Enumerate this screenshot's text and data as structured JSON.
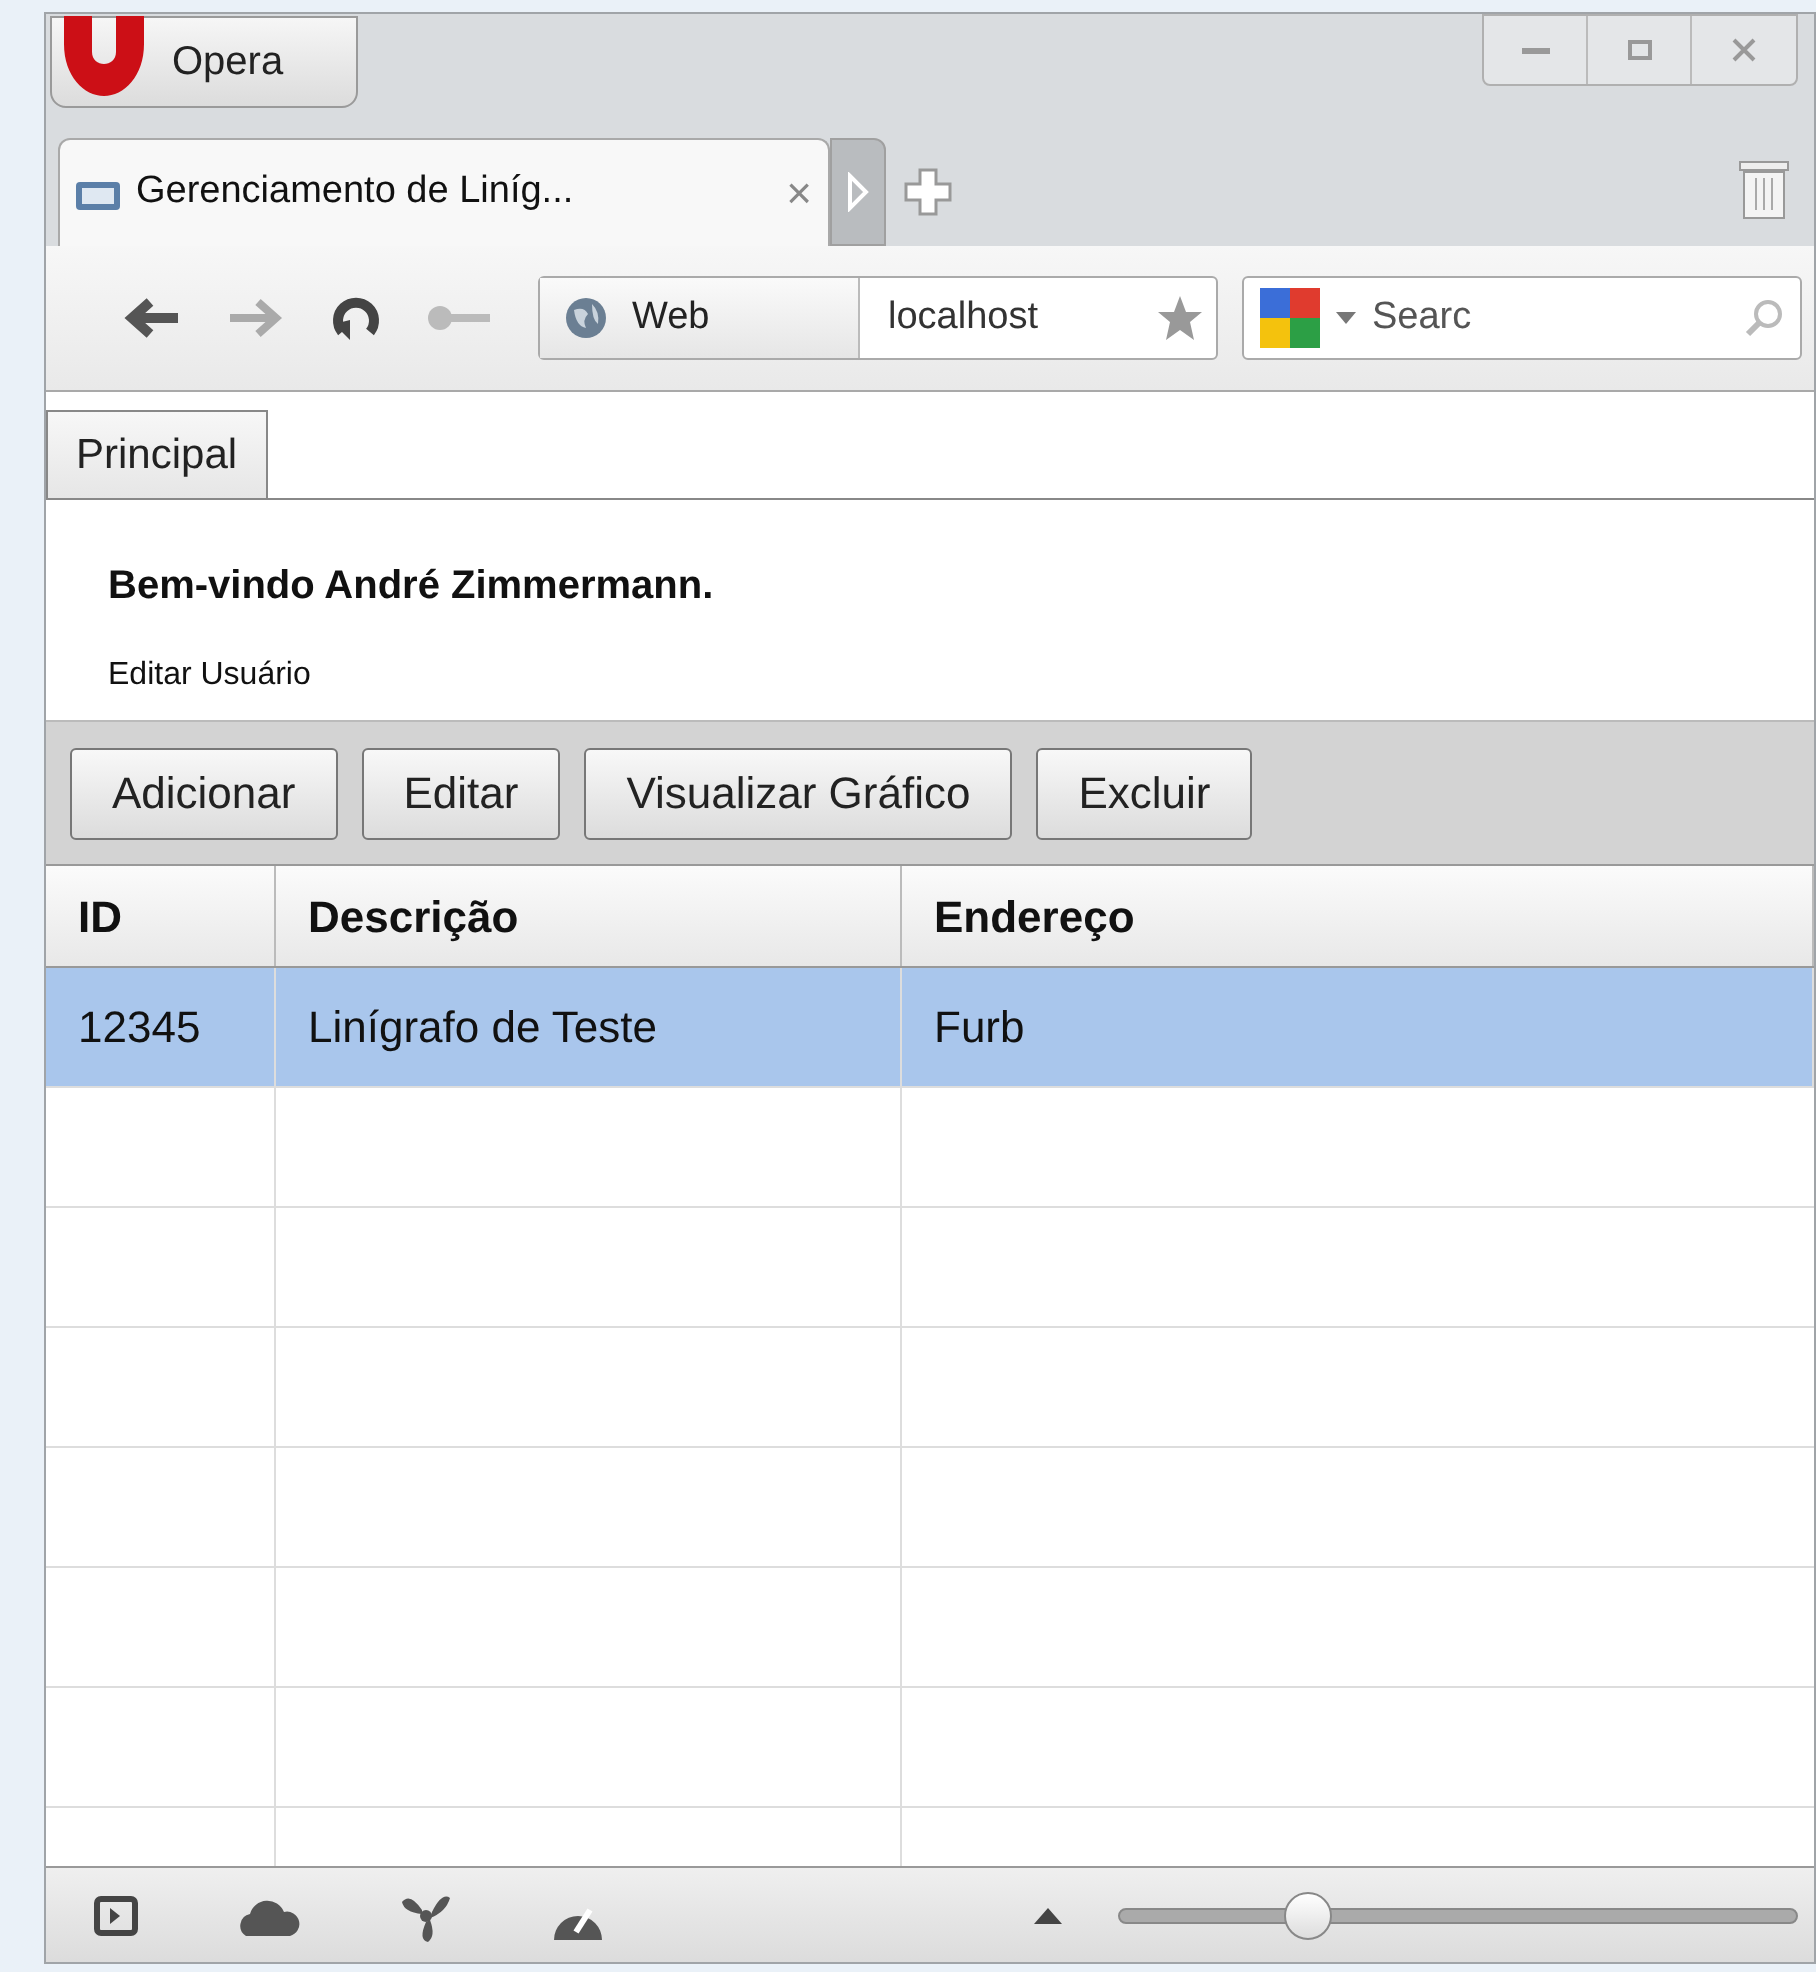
{
  "browser": {
    "menu_button": "Opera",
    "tab": {
      "title": "Gerenciamento de Liníg...",
      "close": "×",
      "selected": true
    },
    "address": {
      "mode": "Web",
      "url": "localhost"
    },
    "search": {
      "placeholder": "Searc"
    }
  },
  "page": {
    "tabs": [
      {
        "label": "Principal",
        "selected": true
      }
    ],
    "welcome": "Bem-vindo André Zimmermann.",
    "edit_user_link": "Editar Usuário",
    "buttons": [
      "Adicionar",
      "Editar",
      "Visualizar Gráfico",
      "Excluir"
    ],
    "table": {
      "columns": [
        "ID",
        "Descrição",
        "Endereço"
      ],
      "rows": [
        {
          "cells": [
            "12345",
            "Linígrafo de Teste",
            "Furb"
          ],
          "selected": true
        }
      ]
    }
  },
  "status_bar": {
    "zoom": {
      "level": 0.28
    }
  }
}
